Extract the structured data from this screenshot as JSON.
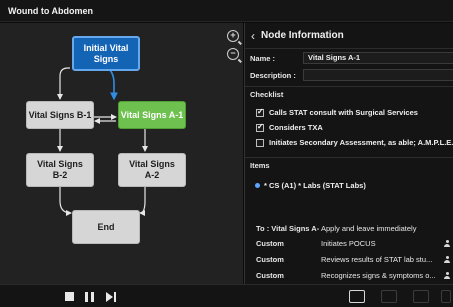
{
  "window": {
    "title": "Wound to Abdomen"
  },
  "canvas": {
    "zoom_in": "zoom-in-icon",
    "zoom_out": "zoom-out-icon",
    "nodes": {
      "initial": "Initial Vital\nSigns",
      "b1": "Vital Signs B-1",
      "a1": "Vital Signs A-1",
      "b2": "Vital Signs\nB-2",
      "a2": "Vital Signs\nA-2",
      "end": "End"
    },
    "colors": {
      "selected_node": "#1464b5",
      "active_node": "#6ec04f",
      "node": "#d6d6d6",
      "background": "#222222"
    }
  },
  "panel": {
    "title": "Node Information",
    "name_label": "Name :",
    "name_value": "Vital Signs A-1",
    "description_label": "Description :",
    "description_value": "",
    "checklist_label": "Checklist",
    "checklist": [
      {
        "label": "Calls STAT consult with Surgical Services",
        "checked": true
      },
      {
        "label": "Considers TXA",
        "checked": true
      },
      {
        "label": "Initiates Secondary Assessment, as able; A.M.P.L.E.",
        "checked": false
      }
    ],
    "items_label": "Items",
    "items": [
      "* CS (A1)  * Labs (STAT Labs)"
    ],
    "transition": {
      "to": "To : Vital Signs A-",
      "action": "Apply and leave immediately",
      "rows": [
        {
          "type": "Custom",
          "text": "Initiates POCUS"
        },
        {
          "type": "Custom",
          "text": "Reviews results of STAT lab stu..."
        },
        {
          "type": "Custom",
          "text": "Recognizes signs & symptoms o..."
        }
      ]
    }
  },
  "controls": {
    "stop": "stop-icon",
    "pause": "pause-icon",
    "skip": "skip-forward-icon"
  }
}
